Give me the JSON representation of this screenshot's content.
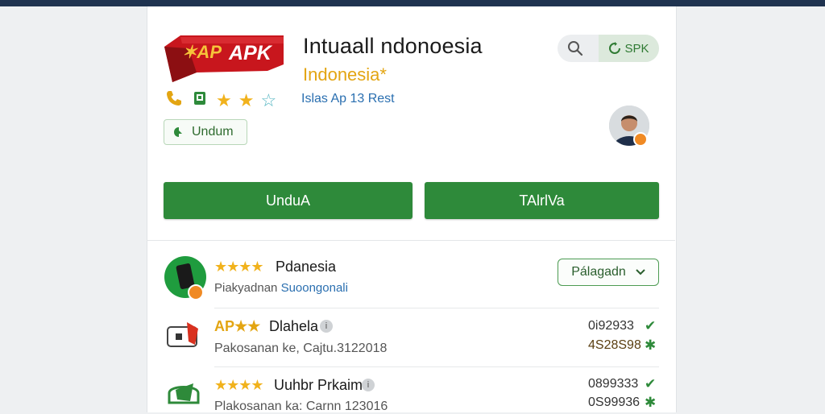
{
  "header": {
    "logo_text": "AP APK",
    "title": "Intuaall ndonoesia",
    "subtitle": "Indonesia*",
    "tagline": "Islas Ap 13 Rest",
    "small_download_label": "Undum",
    "spk_label": "SPK"
  },
  "actions": {
    "primary_label": "UnduA",
    "secondary_label": "TAlrlVa"
  },
  "list": {
    "featured": {
      "title": "Pdanesia",
      "stars": "★★★★",
      "subtitle_a": "Piakyadnan ",
      "subtitle_b": "Suoongonali",
      "dropdown_label": "Pálagadn"
    },
    "rows": [
      {
        "ap_prefix": "AP★★",
        "title": "Dlahela",
        "subtitle": "Pakosanan ke, Cajtu.3122018",
        "num1": "0i92933",
        "num2": "4S28S98"
      },
      {
        "ap_prefix": "★★★★",
        "title": "Uuhbr Prkaim",
        "subtitle": "Plakosanan ka: Carnn 123016",
        "num1": "0899333",
        "num2": "0S99936"
      }
    ]
  },
  "colors": {
    "accent_green": "#2e8a3a",
    "star_gold": "#f1b21c",
    "link_blue": "#2a6fb0",
    "topbar": "#1f3350"
  }
}
